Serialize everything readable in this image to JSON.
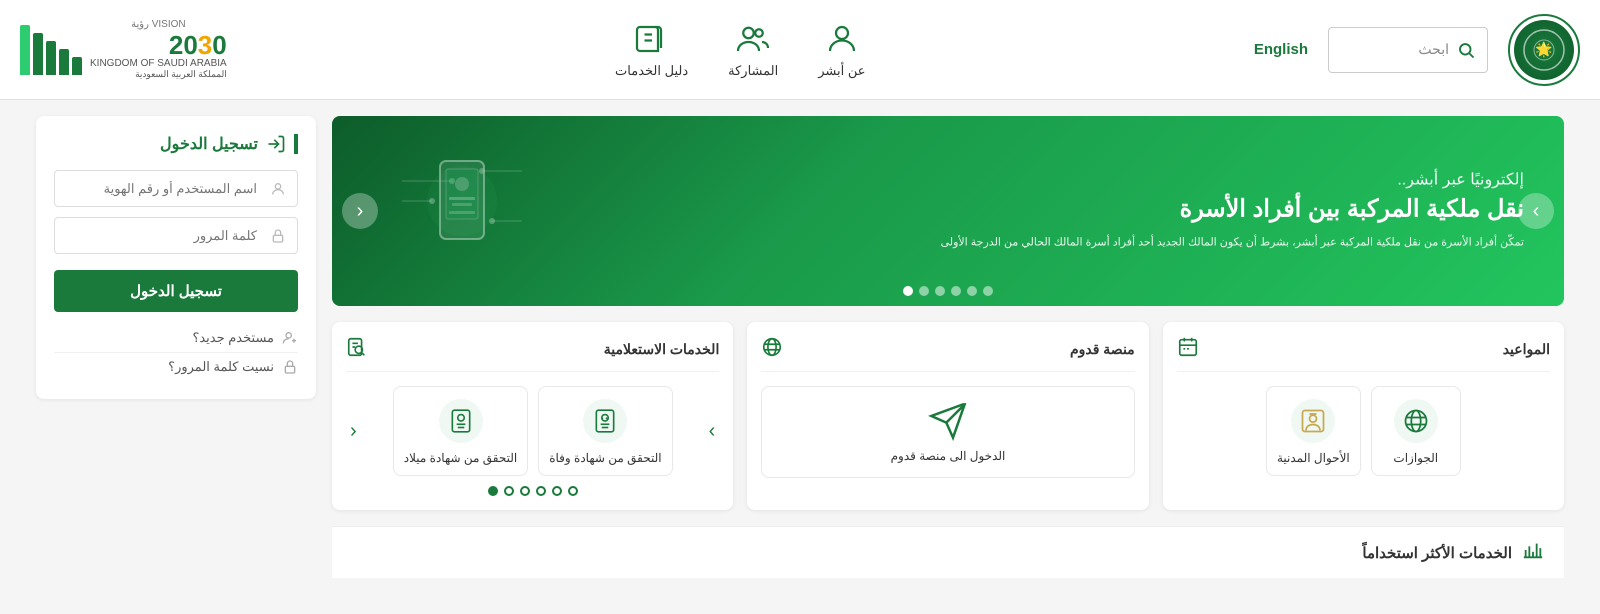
{
  "header": {
    "search_placeholder": "ابحث",
    "english_label": "English",
    "nav_items": [
      {
        "id": "absher",
        "label": "عن أبشر",
        "icon": "person-icon"
      },
      {
        "id": "participation",
        "label": "المشاركة",
        "icon": "users-icon"
      },
      {
        "id": "service_guide",
        "label": "دليل الخدمات",
        "icon": "book-icon"
      }
    ],
    "vision_year": "20",
    "vision_mid": "3",
    "vision_end": "0",
    "vision_sub": "رؤية",
    "vision_country": "المملكة العربية السعودية",
    "vision_country_en": "KINGDOM OF SAUDI ARABIA"
  },
  "banner": {
    "title_small": "إلكترونيًا عبر أبشر..",
    "title_large": "نقل ملكية المركبة بين أفراد الأسرة",
    "description": "تمكّن أفراد الأسرة من نقل ملكية المركبة عبر أبشر، بشرط أن يكون المالك الجديد أحد أفراد أسرة المالك الحالي من الدرجة الأولى",
    "dots_count": 6,
    "active_dot": 5,
    "prev_label": "‹",
    "next_label": "›"
  },
  "appointments_card": {
    "title": "المواعيد",
    "items": [
      {
        "label": "الجوازات",
        "icon": "passports-icon"
      },
      {
        "label": "الأحوال المدنية",
        "icon": "civil-icon"
      }
    ]
  },
  "arrival_card": {
    "title": "منصة قدوم",
    "item_label": "الدخول الى منصة قدوم",
    "icon": "plane-icon"
  },
  "inquiry_card": {
    "title": "الخدمات الاستعلامية",
    "items": [
      {
        "label": "التحقق من شهادة وفاة",
        "icon": "death-cert-icon"
      },
      {
        "label": "التحقق من شهادة ميلاد",
        "icon": "birth-cert-icon"
      }
    ],
    "dots_count": 6,
    "active_dot": 5,
    "prev_label": "‹",
    "next_label": "›"
  },
  "login": {
    "title": "تسجيل الدخول",
    "username_placeholder": "اسم المستخدم أو رقم الهوية",
    "password_placeholder": "كلمة المرور",
    "login_button": "تسجيل الدخول",
    "new_user_label": "مستخدم جديد؟",
    "forgot_password_label": "نسيت كلمة المرور؟"
  },
  "bottom": {
    "title": "الخدمات الأكثر استخداماً"
  },
  "colors": {
    "primary": "#1a7a3c",
    "accent": "#f0a500",
    "bg": "#f5f5f5",
    "white": "#ffffff"
  }
}
